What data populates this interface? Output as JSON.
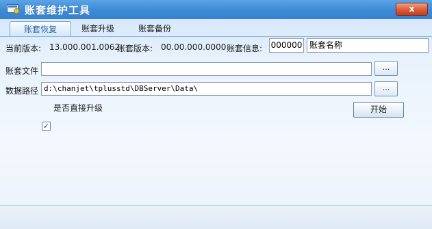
{
  "window": {
    "title": "账套维护工具",
    "close_label": "x",
    "icon": "app-window-icon"
  },
  "tabs": [
    {
      "label": "账套恢复",
      "active": true
    },
    {
      "label": "账套升级",
      "active": false
    },
    {
      "label": "账套备份",
      "active": false
    }
  ],
  "info": {
    "current_version_label": "当前版本:",
    "current_version_value": "13.000.001.0062",
    "account_version_label": "账套版本:",
    "account_version_value": "00.00.000.0000",
    "account_info_label": "账套信息:",
    "account_code": "000000",
    "account_name": "账套名称"
  },
  "form": {
    "file_label": "账套文件",
    "file_value": "",
    "path_label": "数据路径",
    "path_value": "d:\\chanjet\\tplusstd\\DBServer\\Data\\",
    "browse_label": "...",
    "direct_upgrade_label": "是否直接升级",
    "direct_upgrade_checked": true,
    "start_label": "开始"
  },
  "colors": {
    "titlebar": "#3f8bd6",
    "close": "#dc5a38",
    "active_tab_text": "#2c66a8"
  }
}
